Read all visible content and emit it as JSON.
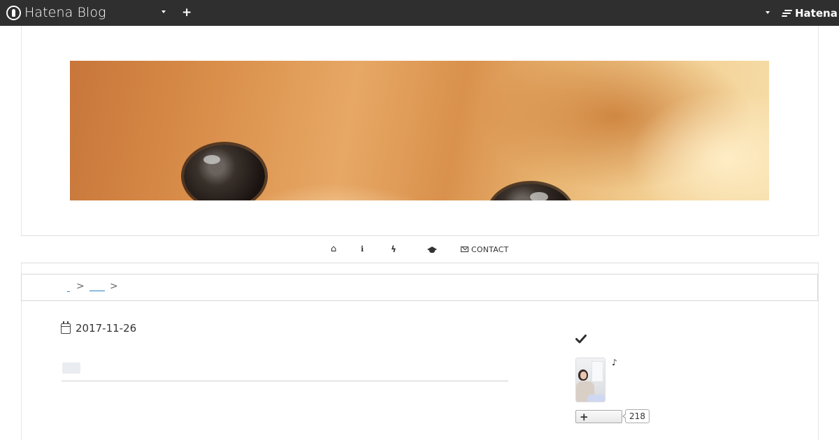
{
  "globalbar": {
    "logo_text": "Hatena Blog",
    "add_label": "+",
    "brand_text": "Hatena",
    "background": "#2f2f2f"
  },
  "header": {
    "image_alt": "Close-up of a dog's eyes header image"
  },
  "nav": {
    "items": [
      {
        "icon": "home-icon",
        "glyph": "⌂",
        "label": ""
      },
      {
        "icon": "info-icon",
        "glyph": "ℹ",
        "label": ""
      },
      {
        "icon": "bolt-icon",
        "glyph": "ϟ",
        "label": ""
      },
      {
        "icon": "graduation-cap-icon",
        "glyph": "🎓",
        "label": ""
      },
      {
        "icon": "envelope-icon",
        "glyph": "✉",
        "label": "CONTACT"
      }
    ]
  },
  "breadcrumb": {
    "separator": ">",
    "link_color": "#2a7fc0"
  },
  "article": {
    "date": "2017-11-26"
  },
  "sidebar": {
    "check_icon": "check-icon",
    "note_symbol": "♪",
    "follow_button_label": "+",
    "follow_count": "218"
  }
}
